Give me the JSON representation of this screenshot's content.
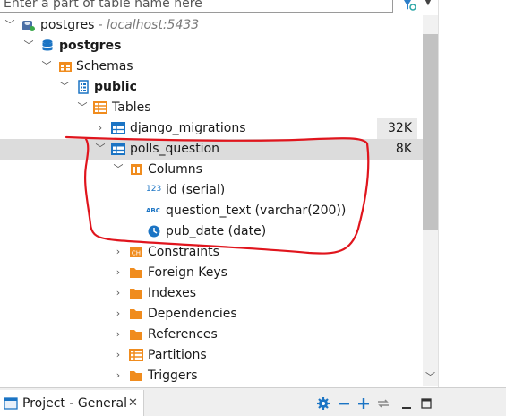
{
  "search": {
    "placeholder": "Enter a part of table name here"
  },
  "tree": {
    "connection": {
      "name": "postgres",
      "host": "- localhost:5433"
    },
    "database": {
      "name": "postgres"
    },
    "schemas": {
      "label": "Schemas"
    },
    "schema": {
      "name": "public"
    },
    "tables": {
      "label": "Tables"
    },
    "table_list": [
      {
        "name": "django_migrations",
        "size": "32K",
        "expanded": false
      },
      {
        "name": "polls_question",
        "size": "8K",
        "expanded": true,
        "selected": true
      }
    ],
    "columns": {
      "label": "Columns",
      "items": [
        {
          "text": "id (serial)",
          "type_icon": "123"
        },
        {
          "text": "question_text (varchar(200))",
          "type_icon": "ABC"
        },
        {
          "text": "pub_date (date)",
          "type_icon": "clock-icon"
        }
      ]
    },
    "folders": [
      {
        "label": "Constraints"
      },
      {
        "label": "Foreign Keys"
      },
      {
        "label": "Indexes"
      },
      {
        "label": "Dependencies"
      },
      {
        "label": "References"
      },
      {
        "label": "Partitions"
      },
      {
        "label": "Triggers"
      }
    ]
  },
  "bottom": {
    "tab_label": "Project - General",
    "tab_close": "✕"
  },
  "colors": {
    "accent_blue": "#1b74c4",
    "folder_orange": "#f08c1e",
    "annotation_red": "#e0151d",
    "selection_gray": "#dcdcdc"
  }
}
